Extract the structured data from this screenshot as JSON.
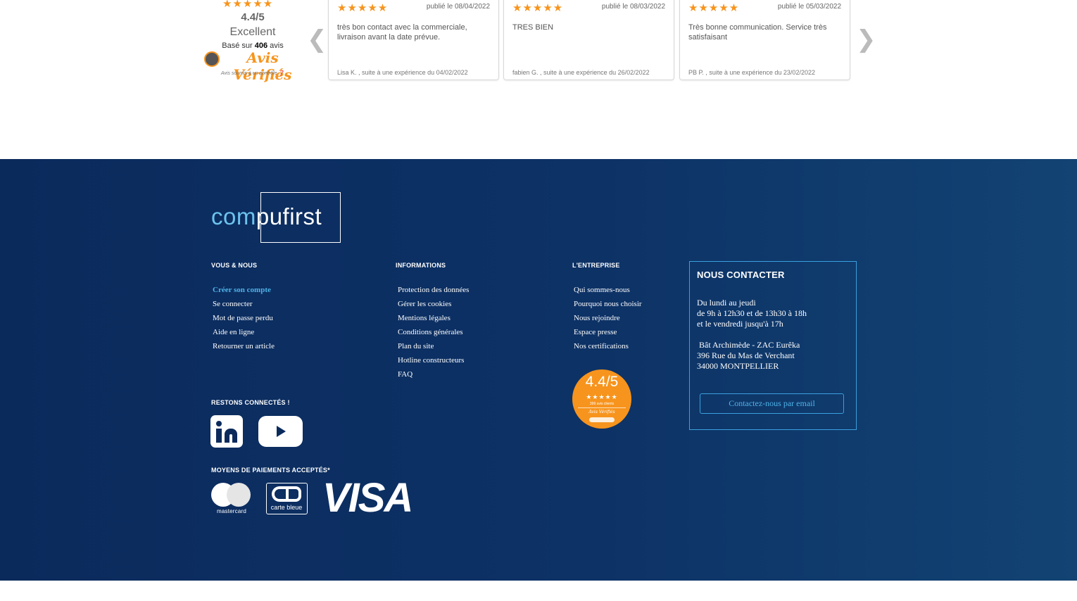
{
  "reviews": {
    "summary": {
      "stars": "★★★★★",
      "rating": "4.4/5",
      "label": "Excellent",
      "based_prefix": "Basé sur",
      "based_count": "406",
      "based_suffix": "avis",
      "brand": "Avis Vérifiés",
      "note": "Avis soumis à un contrôle ❓"
    },
    "prev_icon": "chevron-left-icon",
    "next_icon": "chevron-right-icon",
    "items": [
      {
        "stars": "★★★★★",
        "date": "publié le 08/04/2022",
        "text": "très bon contact avec la commerciale, livraison avant la date prévue.",
        "author": "Lisa K. , suite à une expérience du 04/02/2022"
      },
      {
        "stars": "★★★★★",
        "date": "publié le 08/03/2022",
        "text": "TRES BIEN",
        "author": "fabien G. , suite à une expérience du 26/02/2022"
      },
      {
        "stars": "★★★★★",
        "date": "publié le 05/03/2022",
        "text": "Très bonne communication. Service très satisfaisant",
        "author": "PB P. , suite à une expérience du 23/02/2022"
      }
    ]
  },
  "footer": {
    "brand": {
      "part1": "com",
      "part2": "pufirst"
    },
    "columns": [
      {
        "title": "VOUS & NOUS",
        "links": [
          "Créer son compte",
          "Se connecter",
          "Mot de passe perdu",
          "Aide en ligne",
          "Retourner un article"
        ]
      },
      {
        "title": "INFORMATIONS",
        "links": [
          "Protection des données",
          "Gérer les cookies",
          "Mentions légales",
          "Conditions générales",
          "Plan du site",
          "Hotline constructeurs",
          "FAQ"
        ]
      },
      {
        "title": "L'ENTREPRISE",
        "links": [
          "Qui sommes-nous",
          "Pourquoi nous choisir",
          "Nous rejoindre",
          "Espace presse",
          "Nos certifications"
        ]
      }
    ],
    "badge": {
      "score": "4.4/5",
      "stars": "★★★★★",
      "count": "399 avis clients",
      "brand": "Avis Vérifiés"
    },
    "contact": {
      "title": "NOUS CONTACTER",
      "hours": [
        "Du lundi au jeudi",
        "de 9h à 12h30 et de 13h30 à 18h",
        "et le vendredi jusqu'à 17h"
      ],
      "address": [
        " Bât Archimède - ZAC Eurêka",
        "396 Rue du Mas de Verchant",
        "34000 MONTPELLIER"
      ],
      "button": "Contactez-nous par email"
    },
    "social": {
      "title": "RESTONS CONNECTÉS !",
      "icons": [
        "linkedin-icon",
        "youtube-icon"
      ]
    },
    "payments": {
      "title": "MOYENS DE PAIEMENTS ACCEPTÉS*",
      "mastercard": "mastercard",
      "cb": "carte bleue",
      "visa": "VISA"
    }
  },
  "colors": {
    "accent": "#4fb3e8",
    "star": "#f7941d",
    "footer_bg": "#0b2a5c"
  }
}
